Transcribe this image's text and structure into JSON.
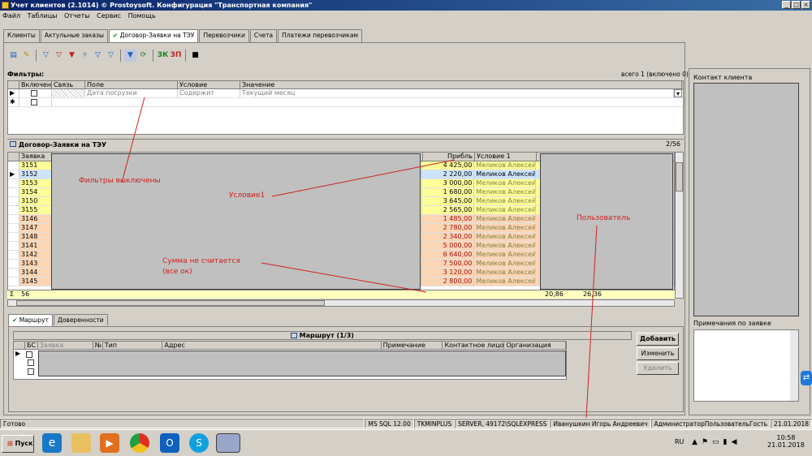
{
  "window": {
    "title": "Учет клиентов (2.1014) © Prostoysoft. Конфигурация \"Транспортная компания\"",
    "min": "_",
    "max": "□",
    "close": "×"
  },
  "menu": [
    "Файл",
    "Таблицы",
    "Отчеты",
    "Сервис",
    "Помощь"
  ],
  "tabs": [
    "Клиенты",
    "Актульные заказы",
    "Договор-Заявки на ТЭУ",
    "Перевозчики",
    "Счета",
    "Платежи перевозчикам"
  ],
  "tab_check": "✔",
  "toolbar": {
    "zk": "ЗК",
    "zp": "ЗП"
  },
  "filters": {
    "heading": "Фильтры:",
    "count": "всего 1 (включено 0)",
    "columns": [
      "Включен",
      "Связь",
      "Поле",
      "Условие",
      "Значение"
    ],
    "rows": [
      {
        "field": "Дата погрузки",
        "condition": "Содержит",
        "value": "Текущий месяц"
      }
    ],
    "new_row_marker": "✱"
  },
  "orders": {
    "heading": "Договор-Заявки на ТЭУ",
    "count": "2/56",
    "col_zayavka": "Заявка",
    "col_pribyl": "Прибль",
    "col_uslovie": "Условие 1",
    "rows": [
      {
        "id": "3151",
        "profit": "4 425,00",
        "cond": "Меликов Алексей Е",
        "color": "yellow"
      },
      {
        "id": "3152",
        "profit": "2 220,00",
        "cond": "Меликов Алексей Е",
        "color": "blue"
      },
      {
        "id": "3153",
        "profit": "3 000,00",
        "cond": "Меликов Алексей Е",
        "color": "yellow"
      },
      {
        "id": "3154",
        "profit": "1 680,00",
        "cond": "Меликов Алексей Е",
        "color": "yellow"
      },
      {
        "id": "3150",
        "profit": "3 645,00",
        "cond": "Меликов Алексей Е",
        "color": "yellow"
      },
      {
        "id": "3155",
        "profit": "2 565,00",
        "cond": "Меликов Алексей Е",
        "color": "yellow"
      },
      {
        "id": "3146",
        "profit": "1 485,00",
        "cond": "Меликов Алексей Е",
        "color": "pink"
      },
      {
        "id": "3147",
        "profit": "2 780,00",
        "cond": "Меликов Алексей Е",
        "color": "pink"
      },
      {
        "id": "3148",
        "profit": "2 340,00",
        "cond": "Меликов Алексей Е",
        "color": "pink"
      },
      {
        "id": "3141",
        "profit": "5 000,00",
        "cond": "Меликов Алексей Е",
        "color": "pink"
      },
      {
        "id": "3142",
        "profit": "6 640,00",
        "cond": "Меликов Алексей Е",
        "color": "pink"
      },
      {
        "id": "3143",
        "profit": "7 500,00",
        "cond": "Меликов Алексей Е",
        "color": "pink"
      },
      {
        "id": "3144",
        "profit": "3 120,00",
        "cond": "Меликов Алексей Е",
        "color": "pink"
      },
      {
        "id": "3145",
        "profit": "2 800,00",
        "cond": "Меликов Алексей Е",
        "color": "pink"
      }
    ],
    "sum_symbol": "Σ",
    "sum_count": "56",
    "sum_a": "20,86",
    "sum_b": "26,36"
  },
  "annotations": {
    "filters_off": "Фильтры выключены",
    "condition1": "Условие1",
    "user": "Пользователь",
    "sum_line1": "Сумма не считается",
    "sum_line2": "(все ок)"
  },
  "route_tabs": [
    "Маршрут",
    "Доверенности"
  ],
  "route": {
    "heading": "Маршрут (1/3)",
    "columns": [
      "БС",
      "Заявка",
      "№",
      "Тип",
      "Адрес",
      "Примечание",
      "Контактное лицо",
      "Организация"
    ],
    "add": "Добавить",
    "edit": "Изменить",
    "delete": "Удалить"
  },
  "right": {
    "contact": "Контакт клиента",
    "notes": "Примечания по заявке"
  },
  "status": [
    "Готово",
    "MS SQL 12.00",
    "TKMINPLUS",
    "SERVER, 49172\\SQLEXPRESS",
    "Иванушкин Игорь Андреевич",
    "АдминистраторПользовательГость",
    "21.01.2018"
  ],
  "taskbar": {
    "start": "Пуск",
    "lang": "RU",
    "time": "10:58",
    "date": "21.01.2018"
  },
  "colors": {
    "yellow": "#ffff99",
    "blue": "#cde4ff",
    "pink": "#fcd5b4",
    "annotation": "#d02020"
  }
}
